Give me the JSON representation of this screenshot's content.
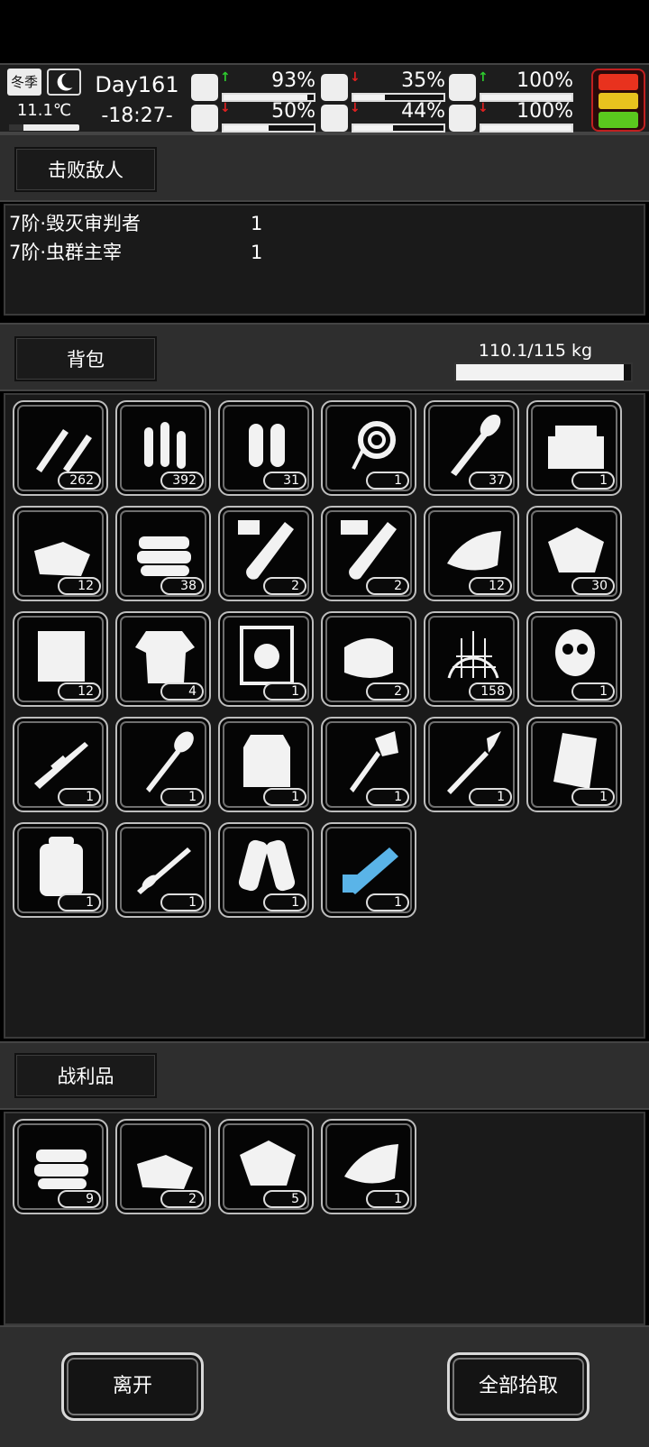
{
  "status": {
    "season": "冬季",
    "temperature": "11.1℃",
    "temperature_fill": 0.2,
    "day": "Day161",
    "time": "-18:27-",
    "stats": [
      {
        "icon": "medkit-icon",
        "trend": "up",
        "value": "93%",
        "level": 0.93
      },
      {
        "icon": "stomach-icon",
        "trend": "down",
        "value": "35%",
        "level": 0.35
      },
      {
        "icon": "pill-icon",
        "trend": "up",
        "value": "100%",
        "level": 1.0
      },
      {
        "icon": "boot-icon",
        "trend": "down",
        "value": "50%",
        "level": 0.5
      },
      {
        "icon": "water-drop-icon",
        "trend": "down",
        "value": "44%",
        "level": 0.44
      },
      {
        "icon": "heart-icon",
        "trend": "down",
        "value": "100%",
        "level": 1.0
      }
    ],
    "alert_colors": [
      "#e8321e",
      "#e8c21e",
      "#5ac81e"
    ]
  },
  "defeated": {
    "header": "击败敌人",
    "enemies": [
      {
        "name": "7阶·毁灭审判者",
        "count": "1"
      },
      {
        "name": "7阶·虫群主宰",
        "count": "1"
      }
    ]
  },
  "backpack": {
    "header": "背包",
    "weight": "110.1/115 kg",
    "weight_fill": 0.957,
    "items": [
      {
        "icon": "rifle-bullets-icon",
        "qty": "262"
      },
      {
        "icon": "bullets-icon",
        "qty": "392"
      },
      {
        "icon": "shotgun-shells-icon",
        "qty": "31"
      },
      {
        "icon": "rope-icon",
        "qty": "1"
      },
      {
        "icon": "rpg-rocket-icon",
        "qty": "37"
      },
      {
        "icon": "toolbox-icon",
        "qty": "1"
      },
      {
        "icon": "cloth-icon",
        "qty": "12"
      },
      {
        "icon": "folded-cloth-icon",
        "qty": "38"
      },
      {
        "icon": "test-tube-v-icon",
        "qty": "2"
      },
      {
        "icon": "test-tube-vii-icon",
        "qty": "2"
      },
      {
        "icon": "leather-icon",
        "qty": "12"
      },
      {
        "icon": "ore-bag-icon",
        "qty": "30"
      },
      {
        "icon": "fabric-sheet-icon",
        "qty": "12"
      },
      {
        "icon": "tattered-shirt-icon",
        "qty": "4"
      },
      {
        "icon": "safe-box-icon",
        "qty": "1"
      },
      {
        "icon": "bandage-icon",
        "qty": "2"
      },
      {
        "icon": "net-icon",
        "qty": "158"
      },
      {
        "icon": "gas-mask-icon",
        "qty": "1"
      },
      {
        "icon": "sniper-rifle-icon",
        "qty": "1"
      },
      {
        "icon": "shovel-icon",
        "qty": "1"
      },
      {
        "icon": "body-armor-icon",
        "qty": "1"
      },
      {
        "icon": "axe-icon",
        "qty": "1"
      },
      {
        "icon": "spear-icon",
        "qty": "1"
      },
      {
        "icon": "riot-shield-icon",
        "qty": "1"
      },
      {
        "icon": "backpack-icon",
        "qty": "1"
      },
      {
        "icon": "rocket-launcher-icon",
        "qty": "1"
      },
      {
        "icon": "gauntlets-icon",
        "qty": "1"
      },
      {
        "icon": "minigun-icon",
        "qty": "1",
        "color": "#5ab4e8"
      }
    ]
  },
  "loot": {
    "header": "战利品",
    "items": [
      {
        "icon": "folded-cloth-icon",
        "qty": "9"
      },
      {
        "icon": "cloth-icon",
        "qty": "2"
      },
      {
        "icon": "ore-bag-icon",
        "qty": "5"
      },
      {
        "icon": "leather-icon",
        "qty": "1"
      }
    ]
  },
  "actions": {
    "leave": "离开",
    "take_all": "全部拾取"
  }
}
